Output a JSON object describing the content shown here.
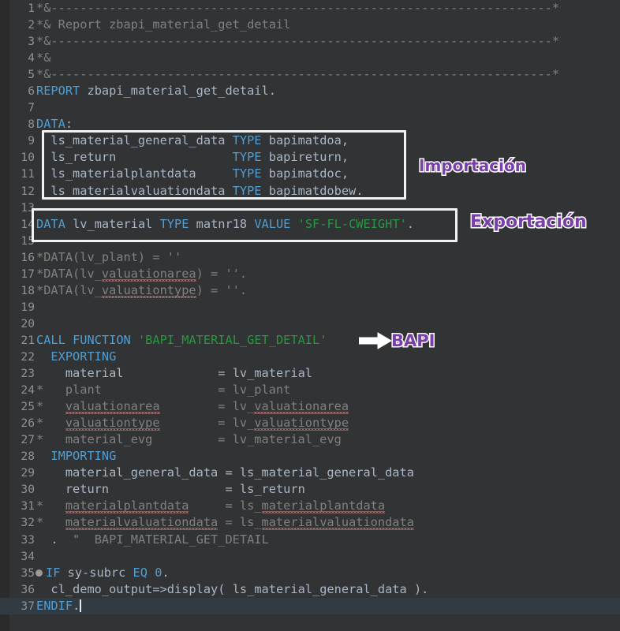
{
  "editor": {
    "theme": "dark",
    "background": "#313335",
    "gutter_background": "#2b2b2b",
    "line_number_color": "#8c9396",
    "text_color": "#a9b7c6",
    "keyword_color": "#4f9fd4",
    "string_color": "#2a9642",
    "comment_color": "#808080",
    "number_color": "#6897bb",
    "annotation_color": "#7a3fa8",
    "annotation_outline_color": "#ffffff",
    "annotation_box_color": "#f2f2f2",
    "current_line": 37,
    "cursor_line": 37,
    "total_lines": 37
  },
  "code": {
    "language": "ABAP",
    "lines": [
      {
        "n": "1",
        "text": "*&---------------------------------------------------------------------*"
      },
      {
        "n": "2",
        "text": "*& Report zbapi_material_get_detail"
      },
      {
        "n": "3",
        "text": "*&---------------------------------------------------------------------*"
      },
      {
        "n": "4",
        "text": "*&"
      },
      {
        "n": "5",
        "text": "*&---------------------------------------------------------------------*"
      },
      {
        "n": "6",
        "text": "REPORT zbapi_material_get_detail."
      },
      {
        "n": "7",
        "text": ""
      },
      {
        "n": "8",
        "text": "DATA:"
      },
      {
        "n": "9",
        "text": "  ls_material_general_data TYPE bapimatdoa,"
      },
      {
        "n": "10",
        "text": "  ls_return                TYPE bapireturn,"
      },
      {
        "n": "11",
        "text": "  ls_materialplantdata     TYPE bapimatdoc,"
      },
      {
        "n": "12",
        "text": "  ls_materialvaluationdata TYPE bapimatdobew."
      },
      {
        "n": "13",
        "text": ""
      },
      {
        "n": "14",
        "text": "DATA lv_material TYPE matnr18 VALUE 'SF-FL-CWEIGHT'."
      },
      {
        "n": "15",
        "text": ""
      },
      {
        "n": "16",
        "text": "*DATA(lv_plant) = ''"
      },
      {
        "n": "17",
        "text": "*DATA(lv_valuationarea) = ''."
      },
      {
        "n": "18",
        "text": "*DATA(lv_valuationtype) = ''."
      },
      {
        "n": "19",
        "text": ""
      },
      {
        "n": "20",
        "text": ""
      },
      {
        "n": "21",
        "text": "CALL FUNCTION 'BAPI_MATERIAL_GET_DETAIL'"
      },
      {
        "n": "22",
        "text": "  EXPORTING"
      },
      {
        "n": "23",
        "text": "    material             = lv_material"
      },
      {
        "n": "24",
        "text": "*   plant                = lv_plant"
      },
      {
        "n": "25",
        "text": "*   valuationarea        = lv_valuationarea"
      },
      {
        "n": "26",
        "text": "*   valuationtype        = lv_valuationtype"
      },
      {
        "n": "27",
        "text": "*   material_evg         = lv_material_evg"
      },
      {
        "n": "28",
        "text": "  IMPORTING"
      },
      {
        "n": "29",
        "text": "    material_general_data = ls_material_general_data"
      },
      {
        "n": "30",
        "text": "    return                = ls_return"
      },
      {
        "n": "31",
        "text": "*   materialplantdata     = ls_materialplantdata"
      },
      {
        "n": "32",
        "text": "*   materialvaluationdata = ls_materialvaluationdata"
      },
      {
        "n": "33",
        "text": "  .  \"  BAPI_MATERIAL_GET_DETAIL"
      },
      {
        "n": "34",
        "text": ""
      },
      {
        "n": "35",
        "text": "IF sy-subrc EQ 0."
      },
      {
        "n": "36",
        "text": "  cl_demo_output=>display( ls_material_general_data )."
      },
      {
        "n": "37",
        "text": "ENDIF."
      }
    ]
  },
  "annotations": {
    "importacion_label": "Importación",
    "exportacion_label": "Exportación",
    "bapi_label": "BAPI",
    "arrow_icon": "right-arrow-icon"
  }
}
